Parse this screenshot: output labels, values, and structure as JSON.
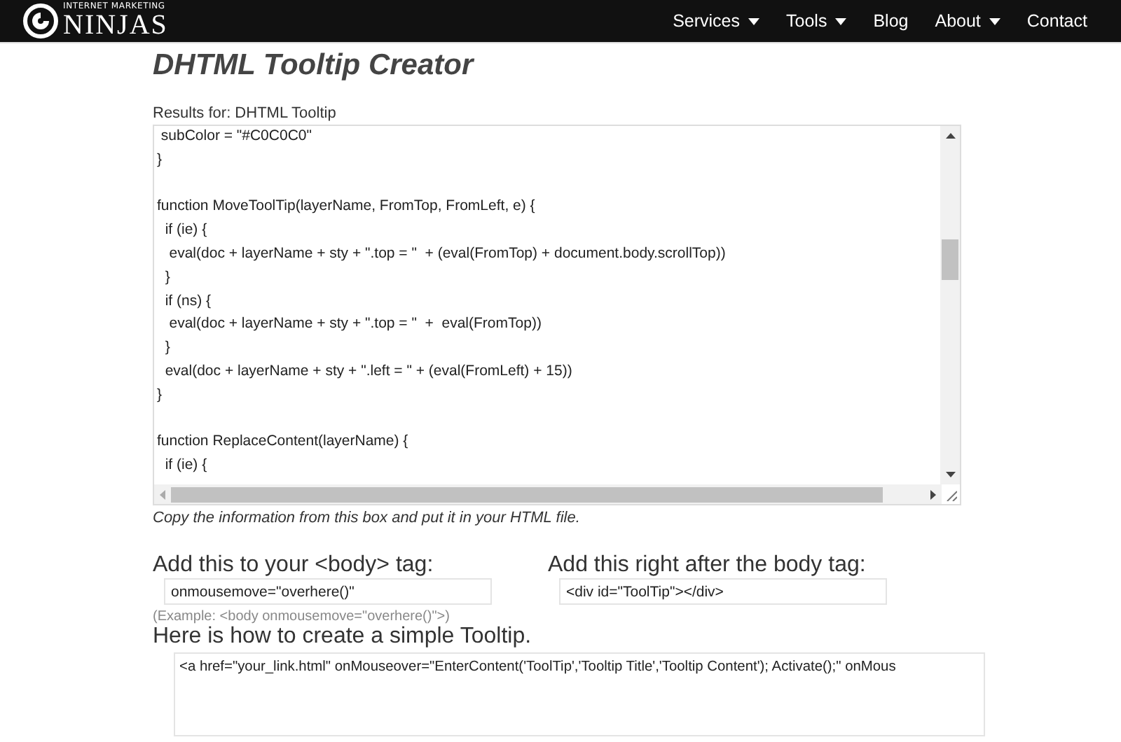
{
  "header": {
    "logo": {
      "tagline": "INTERNET MARKETING",
      "name": "NINJAS"
    },
    "nav": [
      {
        "label": "Services",
        "dropdown": true
      },
      {
        "label": "Tools",
        "dropdown": true
      },
      {
        "label": "Blog",
        "dropdown": false
      },
      {
        "label": "About",
        "dropdown": true
      },
      {
        "label": "Contact",
        "dropdown": false
      }
    ]
  },
  "title": "DHTML Tooltip Creator",
  "results_label": "Results for: DHTML Tooltip",
  "code_box": {
    "blocks": [
      [
        " subColor = \"#C0C0C0\"",
        "}"
      ],
      [
        "function MoveToolTip(layerName, FromTop, FromLeft, e) {",
        "  if (ie) {",
        "   eval(doc + layerName + sty + \".top = \"  + (eval(FromTop) + document.body.scrollTop))",
        "  }",
        "  if (ns) {",
        "   eval(doc + layerName + sty + \".top = \"  +  eval(FromTop))",
        "  }",
        "  eval(doc + layerName + sty + \".left = \" + (eval(FromLeft) + 15))",
        "}"
      ],
      [
        "function ReplaceContent(layerName) {",
        "  if (ie) {"
      ]
    ]
  },
  "code_caption": "Copy the information from this box and put it in your HTML file.",
  "body_tag": {
    "heading": "Add this to your <body> tag:",
    "value": "onmousemove=\"overhere()\"",
    "example": "(Example: <body onmousemove=\"overhere()\">)"
  },
  "after_body": {
    "heading": "Add this right after the body tag:",
    "value": "<div id=\"ToolTip\"></div>"
  },
  "simple": {
    "heading": "Here is how to create a simple Tooltip.",
    "value": "<a href=\"your_link.html\" onMouseover=\"EnterContent('ToolTip','Tooltip Title','Tooltip Content'); Activate();\" onMous"
  }
}
